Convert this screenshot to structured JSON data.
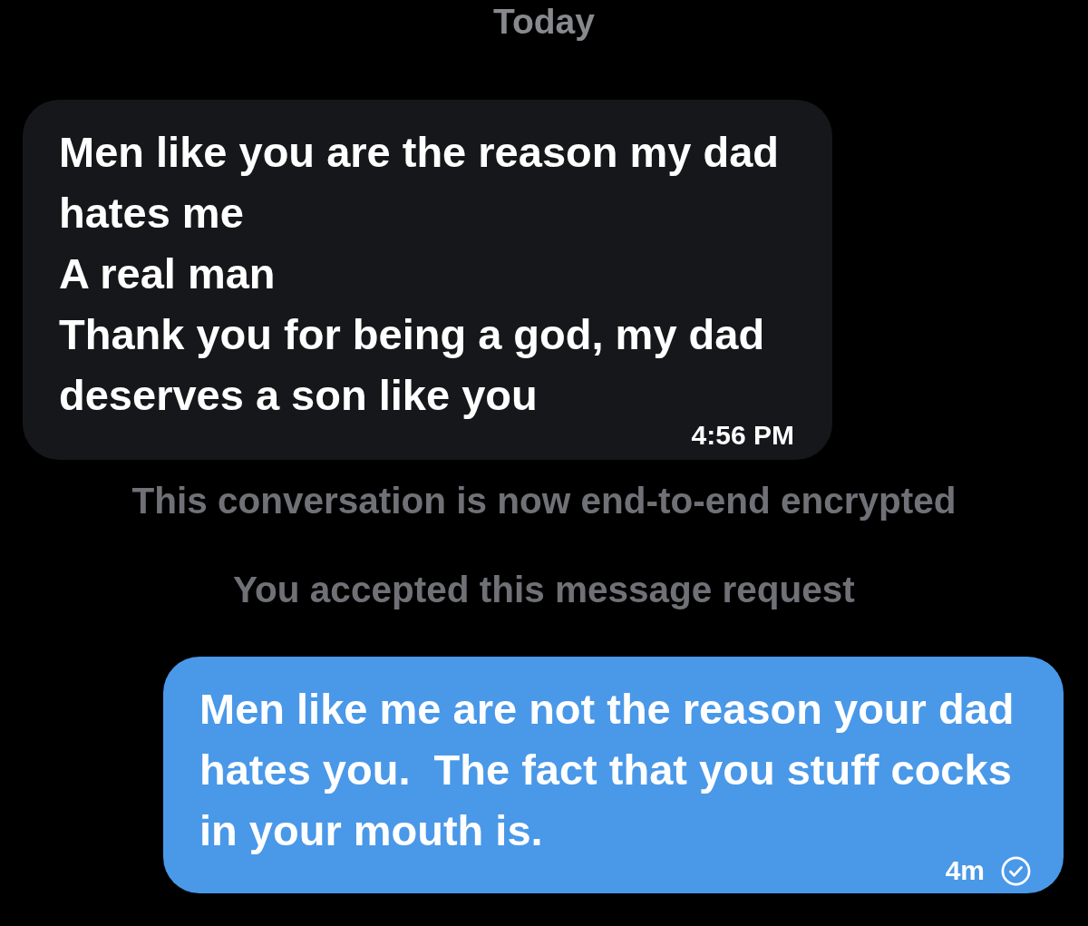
{
  "timeline": [
    {
      "kind": "date",
      "text": "Today"
    },
    {
      "kind": "received",
      "text": "Men like you are the reason my dad hates me\nA real man\nThank you for being a god, my dad deserves a son like you",
      "time": "4:56 PM"
    },
    {
      "kind": "notice",
      "text": "This conversation is now end-to-end encrypted"
    },
    {
      "kind": "notice",
      "text": "You accepted this message request"
    },
    {
      "kind": "sent",
      "text": "Men like me are not the reason your dad hates you.  The fact that you stuff cocks in your mouth is.",
      "time": "4m",
      "delivered": true
    }
  ]
}
